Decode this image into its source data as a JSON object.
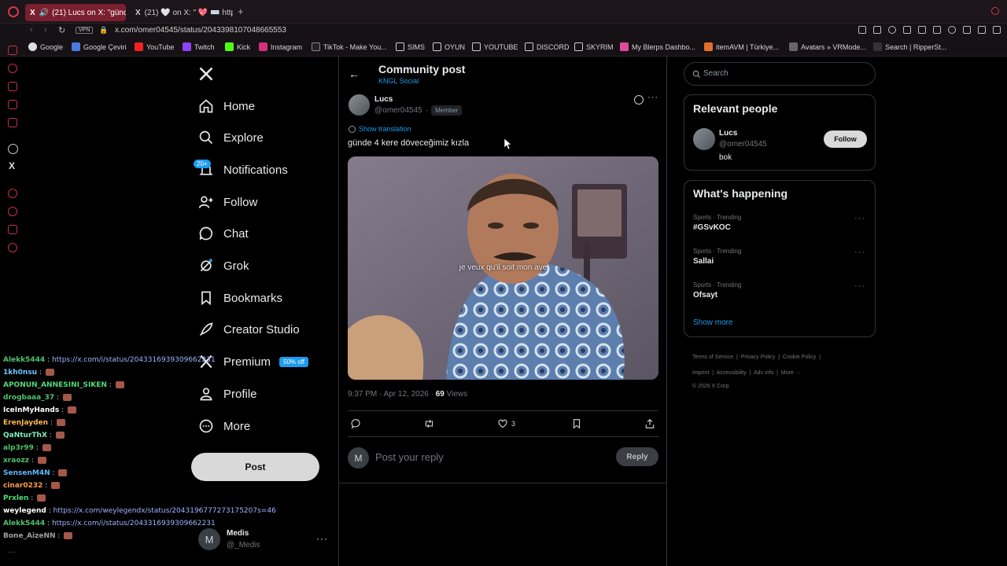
{
  "browser": {
    "tabs": [
      {
        "label": "(21) Lucs on X: \"günde"
      },
      {
        "label": "(21) 🤍 on X: \" 💖 ⌨️ https"
      }
    ],
    "vpn": "VPN",
    "url": "x.com/omer04545/status/2043398107048665553",
    "bookmarks": [
      "Google",
      "Google Çeviri",
      "YouTube",
      "Twitch",
      "Kick",
      "Instagram",
      "TikTok - Make You...",
      "SIMS",
      "OYUN",
      "YOUTUBE",
      "DISCORD",
      "SKYRIM",
      "My Blerps Dashbo...",
      "itemAVM | Türkiye...",
      "Avatars » VRMode...",
      "Search | RipperSt..."
    ]
  },
  "nav": {
    "home": "Home",
    "explore": "Explore",
    "notifications": "Notifications",
    "notifications_badge": "20+",
    "follow": "Follow",
    "chat": "Chat",
    "grok": "Grok",
    "bookmarks": "Bookmarks",
    "creator_studio": "Creator Studio",
    "premium": "Premium",
    "premium_badge": "50% off",
    "profile": "Profile",
    "more": "More",
    "post_button": "Post",
    "account_initial": "M",
    "account_name": "Medis",
    "account_handle": "@_Medis"
  },
  "post": {
    "header_title": "Community post",
    "community": "KNGL Social",
    "author_name": "Lucs",
    "author_handle": "@omer04545",
    "separator": "·",
    "member_badge": "Member",
    "show_translation": "Show translation",
    "text": "günde 4 kere döveceğimiz kızla",
    "video_caption": "je veux qu'il soit mon ave",
    "time": "9:37 PM · Apr 12, 2026 ·",
    "views_count": "69",
    "views_label": "Views",
    "likes": "3",
    "reply_initial": "M",
    "reply_placeholder": "Post your reply",
    "reply_button": "Reply"
  },
  "sidebar": {
    "search_placeholder": "Search",
    "relevant_title": "Relevant people",
    "person_name": "Lucs",
    "person_handle": "@omer04545",
    "person_bio": "bok",
    "follow_button": "Follow",
    "happening_title": "What's happening",
    "trends": [
      {
        "category": "Sports · Trending",
        "name": "#GSvKOC"
      },
      {
        "category": "Sports · Trending",
        "name": "Sallai"
      },
      {
        "category": "Sports · Trending",
        "name": "Ofsayt"
      }
    ],
    "show_more": "Show more",
    "footer": [
      "Terms of Service",
      "Privacy Policy",
      "Cookie Policy",
      "Imprint",
      "Accessibility",
      "Ads info",
      "More ···"
    ],
    "copyright": "© 2026 X Corp."
  },
  "chat": {
    "lines": [
      {
        "user": "Alekk5444",
        "msg": "https://x.com/i/status/2043316939309662231",
        "color": "#4fc26b",
        "link": true
      },
      {
        "user": "1kh0nsu",
        "msg": "",
        "color": "#6cc6ff",
        "emote": true
      },
      {
        "user": "APONUN_ANNESINI_SIKEN",
        "msg": "",
        "color": "#4fdc7a",
        "emote": true
      },
      {
        "user": "drogbaaa_37",
        "msg": "",
        "color": "#4fc26b",
        "emote": true
      },
      {
        "user": "IceInMyHands",
        "msg": "",
        "color": "#ffffff",
        "emote": true
      },
      {
        "user": "ErenJayden",
        "msg": "",
        "color": "#ffb84d",
        "emote": true
      },
      {
        "user": "QaNturThX",
        "msg": "",
        "color": "#7cf0c4",
        "emote": true
      },
      {
        "user": "alp3r99",
        "msg": "",
        "color": "#4fc26b",
        "emote": true
      },
      {
        "user": "xraozz",
        "msg": "",
        "color": "#4fc26b",
        "emote": true
      },
      {
        "user": "SensenM4N",
        "msg": "",
        "color": "#5fb8ff",
        "emote": true
      },
      {
        "user": "cinar0232",
        "msg": "",
        "color": "#ff9d4d",
        "emote": true
      },
      {
        "user": "Prxlen",
        "msg": "",
        "color": "#4fdc7a",
        "emote": true
      },
      {
        "user": "weylegend",
        "msg": "https://x.com/weylegendx/status/2043196777273175207s=46",
        "color": "#ffffff",
        "link": true
      },
      {
        "user": "Alekk5444",
        "msg": "https://x.com/i/status/2043316939309662231",
        "color": "#4fc26b",
        "link": true
      },
      {
        "user": "Bone_AizeNN",
        "msg": "",
        "color": "#a0a0a0",
        "emote": true
      }
    ]
  },
  "colors": {
    "accent_blue": "#1d9bf0",
    "opera_red": "#c2324a",
    "chat_link": "#9fb4ff"
  }
}
